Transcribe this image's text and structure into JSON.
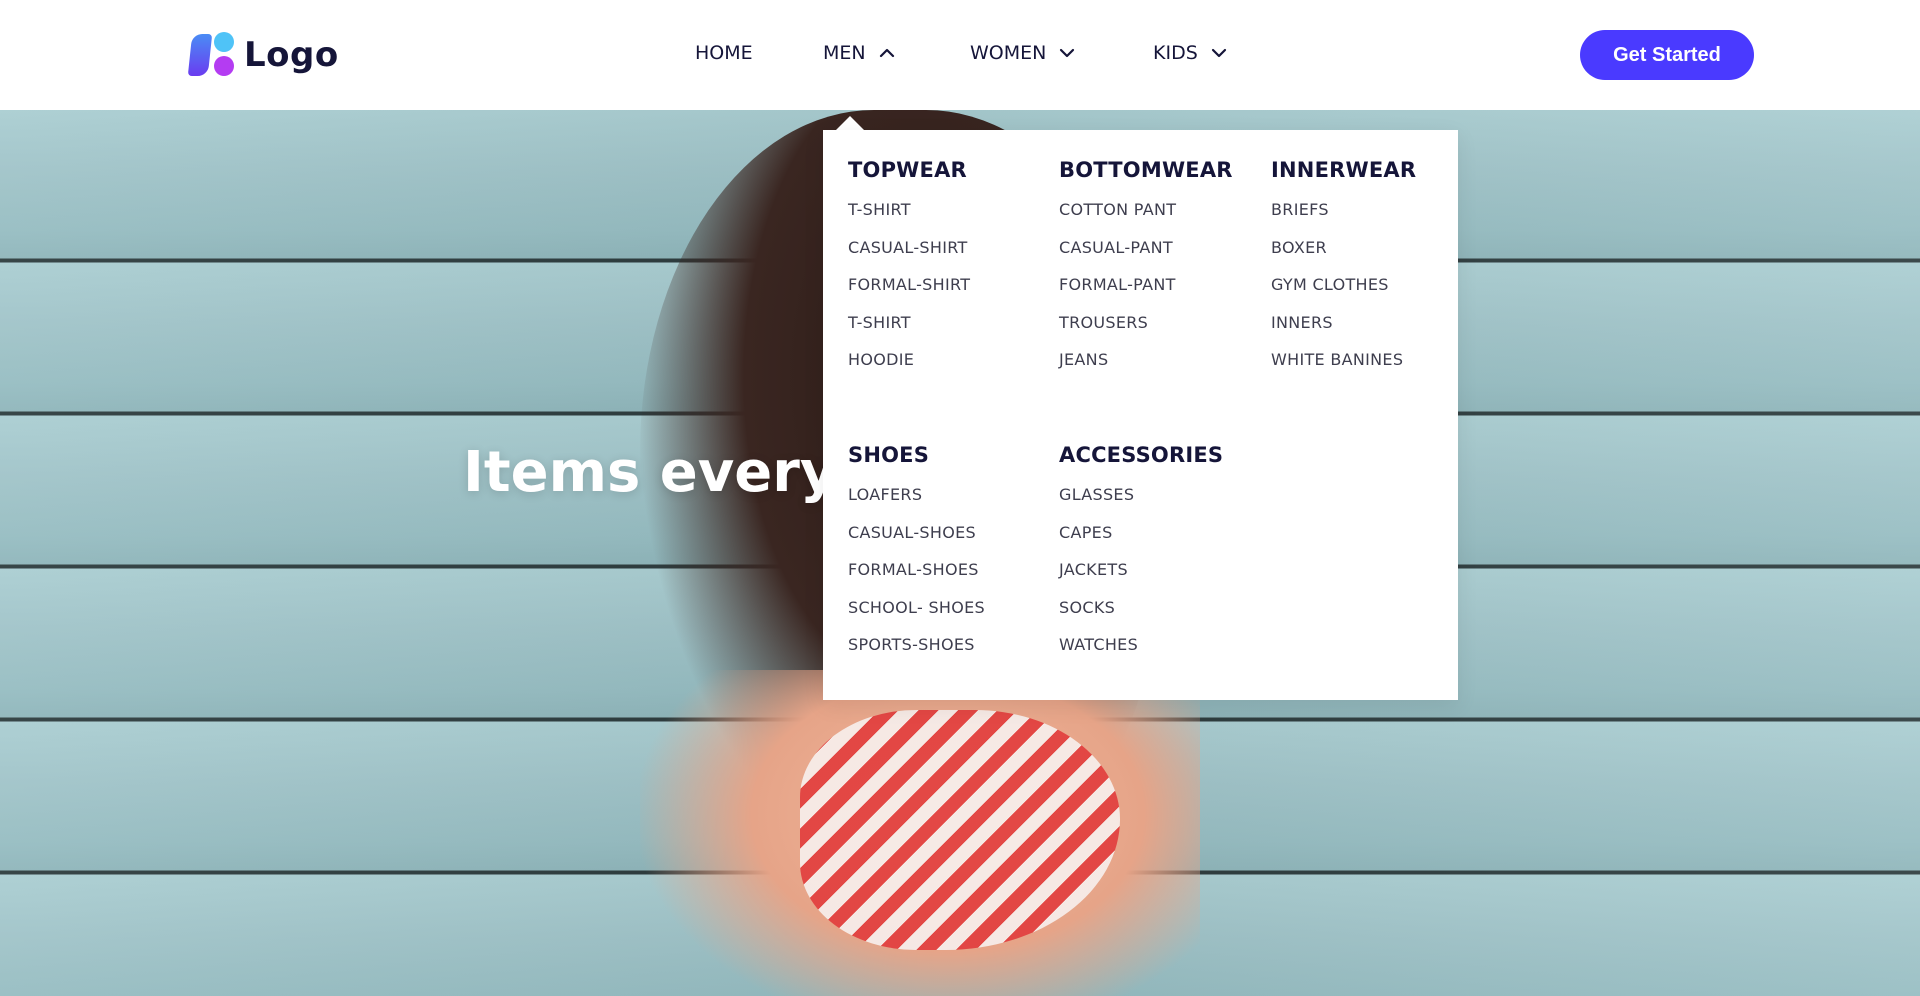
{
  "brand": {
    "name": "Logo"
  },
  "nav": {
    "items": [
      {
        "label": "HOME"
      },
      {
        "label": "MEN",
        "state": "expanded"
      },
      {
        "label": "WOMEN"
      },
      {
        "label": "KIDS"
      }
    ]
  },
  "cta": {
    "label": "Get Started",
    "color": "#4a3aff"
  },
  "hero": {
    "title": "Items every"
  },
  "mega_menu": {
    "columns": [
      {
        "title": "TOPWEAR",
        "items": [
          "T-SHIRT",
          "CASUAL-SHIRT",
          "FORMAL-SHIRT",
          "T-SHIRT",
          "HOODIE"
        ]
      },
      {
        "title": "BOTTOMWEAR",
        "items": [
          "COTTON PANT",
          "CASUAL-PANT",
          "FORMAL-PANT",
          "TROUSERS",
          "JEANS"
        ]
      },
      {
        "title": "INNERWEAR",
        "items": [
          "BRIEFS",
          "BOXER",
          "GYM CLOTHES",
          "INNERS",
          "WHITE BANINES"
        ]
      },
      {
        "title": "SHOES",
        "items": [
          "LOAFERS",
          "CASUAL-SHOES",
          "FORMAL-SHOES",
          "SCHOOL- SHOES",
          "SPORTS-SHOES"
        ]
      },
      {
        "title": "ACCESSORIES",
        "items": [
          "GLASSES",
          "CAPES",
          "JACKETS",
          "SOCKS",
          "WATCHES"
        ]
      }
    ]
  },
  "icons": {
    "men_chevron": "chevron-up-icon",
    "women_chevron": "chevron-down-icon",
    "kids_chevron": "chevron-down-icon"
  }
}
